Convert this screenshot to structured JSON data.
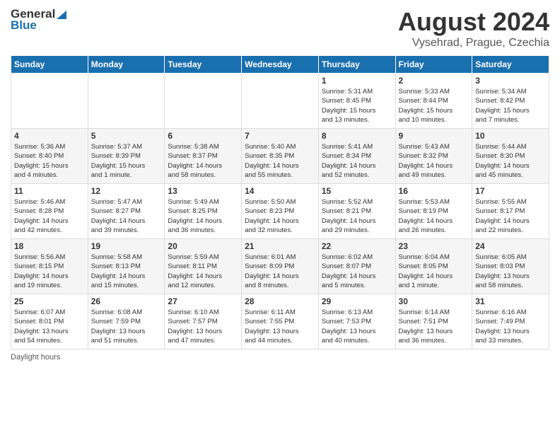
{
  "header": {
    "logo_line1": "General",
    "logo_line2": "Blue",
    "month_title": "August 2024",
    "location": "Vysehrad, Prague, Czechia"
  },
  "weekdays": [
    "Sunday",
    "Monday",
    "Tuesday",
    "Wednesday",
    "Thursday",
    "Friday",
    "Saturday"
  ],
  "weeks": [
    [
      {
        "day": "",
        "info": ""
      },
      {
        "day": "",
        "info": ""
      },
      {
        "day": "",
        "info": ""
      },
      {
        "day": "",
        "info": ""
      },
      {
        "day": "1",
        "info": "Sunrise: 5:31 AM\nSunset: 8:45 PM\nDaylight: 15 hours\nand 13 minutes."
      },
      {
        "day": "2",
        "info": "Sunrise: 5:33 AM\nSunset: 8:44 PM\nDaylight: 15 hours\nand 10 minutes."
      },
      {
        "day": "3",
        "info": "Sunrise: 5:34 AM\nSunset: 8:42 PM\nDaylight: 15 hours\nand 7 minutes."
      }
    ],
    [
      {
        "day": "4",
        "info": "Sunrise: 5:36 AM\nSunset: 8:40 PM\nDaylight: 15 hours\nand 4 minutes."
      },
      {
        "day": "5",
        "info": "Sunrise: 5:37 AM\nSunset: 8:39 PM\nDaylight: 15 hours\nand 1 minute."
      },
      {
        "day": "6",
        "info": "Sunrise: 5:38 AM\nSunset: 8:37 PM\nDaylight: 14 hours\nand 58 minutes."
      },
      {
        "day": "7",
        "info": "Sunrise: 5:40 AM\nSunset: 8:35 PM\nDaylight: 14 hours\nand 55 minutes."
      },
      {
        "day": "8",
        "info": "Sunrise: 5:41 AM\nSunset: 8:34 PM\nDaylight: 14 hours\nand 52 minutes."
      },
      {
        "day": "9",
        "info": "Sunrise: 5:43 AM\nSunset: 8:32 PM\nDaylight: 14 hours\nand 49 minutes."
      },
      {
        "day": "10",
        "info": "Sunrise: 5:44 AM\nSunset: 8:30 PM\nDaylight: 14 hours\nand 45 minutes."
      }
    ],
    [
      {
        "day": "11",
        "info": "Sunrise: 5:46 AM\nSunset: 8:28 PM\nDaylight: 14 hours\nand 42 minutes."
      },
      {
        "day": "12",
        "info": "Sunrise: 5:47 AM\nSunset: 8:27 PM\nDaylight: 14 hours\nand 39 minutes."
      },
      {
        "day": "13",
        "info": "Sunrise: 5:49 AM\nSunset: 8:25 PM\nDaylight: 14 hours\nand 36 minutes."
      },
      {
        "day": "14",
        "info": "Sunrise: 5:50 AM\nSunset: 8:23 PM\nDaylight: 14 hours\nand 32 minutes."
      },
      {
        "day": "15",
        "info": "Sunrise: 5:52 AM\nSunset: 8:21 PM\nDaylight: 14 hours\nand 29 minutes."
      },
      {
        "day": "16",
        "info": "Sunrise: 5:53 AM\nSunset: 8:19 PM\nDaylight: 14 hours\nand 26 minutes."
      },
      {
        "day": "17",
        "info": "Sunrise: 5:55 AM\nSunset: 8:17 PM\nDaylight: 14 hours\nand 22 minutes."
      }
    ],
    [
      {
        "day": "18",
        "info": "Sunrise: 5:56 AM\nSunset: 8:15 PM\nDaylight: 14 hours\nand 19 minutes."
      },
      {
        "day": "19",
        "info": "Sunrise: 5:58 AM\nSunset: 8:13 PM\nDaylight: 14 hours\nand 15 minutes."
      },
      {
        "day": "20",
        "info": "Sunrise: 5:59 AM\nSunset: 8:11 PM\nDaylight: 14 hours\nand 12 minutes."
      },
      {
        "day": "21",
        "info": "Sunrise: 6:01 AM\nSunset: 8:09 PM\nDaylight: 14 hours\nand 8 minutes."
      },
      {
        "day": "22",
        "info": "Sunrise: 6:02 AM\nSunset: 8:07 PM\nDaylight: 14 hours\nand 5 minutes."
      },
      {
        "day": "23",
        "info": "Sunrise: 6:04 AM\nSunset: 8:05 PM\nDaylight: 14 hours\nand 1 minute."
      },
      {
        "day": "24",
        "info": "Sunrise: 6:05 AM\nSunset: 8:03 PM\nDaylight: 13 hours\nand 58 minutes."
      }
    ],
    [
      {
        "day": "25",
        "info": "Sunrise: 6:07 AM\nSunset: 8:01 PM\nDaylight: 13 hours\nand 54 minutes."
      },
      {
        "day": "26",
        "info": "Sunrise: 6:08 AM\nSunset: 7:59 PM\nDaylight: 13 hours\nand 51 minutes."
      },
      {
        "day": "27",
        "info": "Sunrise: 6:10 AM\nSunset: 7:57 PM\nDaylight: 13 hours\nand 47 minutes."
      },
      {
        "day": "28",
        "info": "Sunrise: 6:11 AM\nSunset: 7:55 PM\nDaylight: 13 hours\nand 44 minutes."
      },
      {
        "day": "29",
        "info": "Sunrise: 6:13 AM\nSunset: 7:53 PM\nDaylight: 13 hours\nand 40 minutes."
      },
      {
        "day": "30",
        "info": "Sunrise: 6:14 AM\nSunset: 7:51 PM\nDaylight: 13 hours\nand 36 minutes."
      },
      {
        "day": "31",
        "info": "Sunrise: 6:16 AM\nSunset: 7:49 PM\nDaylight: 13 hours\nand 33 minutes."
      }
    ]
  ],
  "footer": {
    "daylight_label": "Daylight hours"
  }
}
